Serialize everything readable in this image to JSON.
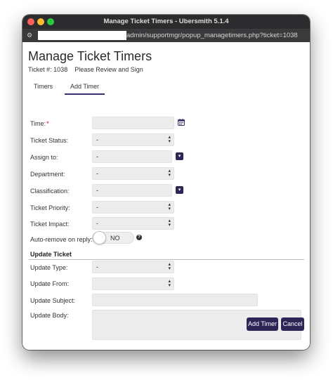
{
  "window": {
    "title": "Manage Ticket Timers - Ubersmith 5.1.4",
    "url": "admin/supportmgr/popup_managetimers.php?ticket=1038"
  },
  "page": {
    "title": "Manage Ticket Timers",
    "ticket_label": "Ticket #: 1038",
    "instruction": "Please Review and Sign"
  },
  "tabs": [
    {
      "label": "Timers",
      "active": false
    },
    {
      "label": "Add Timer",
      "active": true
    }
  ],
  "form": {
    "time_label": "Time:",
    "required_mark": "*",
    "time_value": "",
    "ticket_status": {
      "label": "Ticket Status:",
      "value": "-"
    },
    "assign_to": {
      "label": "Assign to:",
      "value": "-"
    },
    "department": {
      "label": "Department:",
      "value": "-"
    },
    "classification": {
      "label": "Classification:",
      "value": "-"
    },
    "ticket_priority": {
      "label": "Ticket Priority:",
      "value": "-"
    },
    "ticket_impact": {
      "label": "Ticket Impact:",
      "value": "-"
    },
    "auto_remove": {
      "label": "Auto-remove on reply:",
      "value": "NO"
    }
  },
  "update_section": {
    "heading": "Update Ticket",
    "update_type": {
      "label": "Update Type:",
      "value": "-"
    },
    "update_from": {
      "label": "Update From:",
      "value": ""
    },
    "update_subject": {
      "label": "Update Subject:",
      "value": ""
    },
    "update_body": {
      "label": "Update Body:",
      "value": ""
    }
  },
  "buttons": {
    "add_timer": "Add Timer",
    "cancel": "Cancel"
  },
  "colors": {
    "accent": "#2e2557",
    "required": "#d0021b"
  }
}
